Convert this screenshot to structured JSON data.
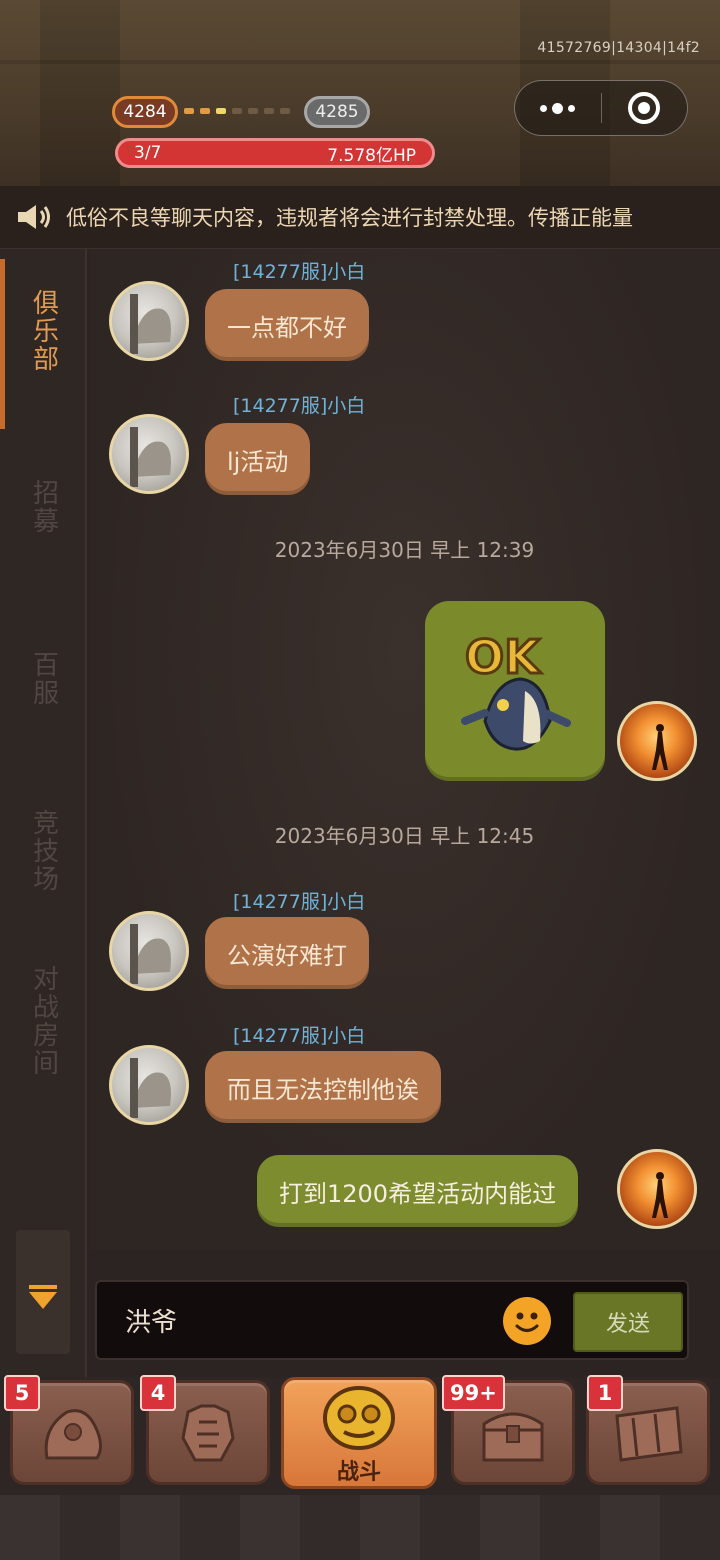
{
  "header": {
    "id_text": "41572769|14304|14f2",
    "level_current": "4284",
    "level_next": "4285",
    "wave": "3/7",
    "boss_hp": "7.578亿HP"
  },
  "notice": {
    "text": "低俗不良等聊天内容，违规者将会进行封禁处理。传播正能量"
  },
  "sidebar": {
    "tabs": [
      {
        "label": "俱乐部",
        "active": true
      },
      {
        "label": "招募",
        "active": false
      },
      {
        "label": "百服",
        "active": false
      },
      {
        "label": "竞技场",
        "active": false
      },
      {
        "label": "对战房间",
        "active": false
      }
    ]
  },
  "chat": {
    "messages": [
      {
        "sender": "[14277服]小白",
        "text": "一点都不好",
        "side": "left"
      },
      {
        "sender": "[14277服]小白",
        "text": "lj活动",
        "side": "left"
      },
      {
        "timestamp": "2023年6月30日  早上  12:39"
      },
      {
        "sticker_text": "OK",
        "side": "right"
      },
      {
        "timestamp": "2023年6月30日  早上  12:45"
      },
      {
        "sender": "[14277服]小白",
        "text": "公演好难打",
        "side": "left"
      },
      {
        "sender": "[14277服]小白",
        "text": "而且无法控制他诶",
        "side": "left"
      },
      {
        "text": "打到1200希望活动内能过",
        "side": "right"
      }
    ]
  },
  "input": {
    "value": "洪爷",
    "send_label": "发送"
  },
  "bottom_nav": {
    "items": [
      {
        "icon": "hero-icon",
        "badge": "5"
      },
      {
        "icon": "armor-icon",
        "badge": "4"
      },
      {
        "icon": "battle-icon",
        "label": "战斗",
        "active": true
      },
      {
        "icon": "chest-icon",
        "badge": "99+"
      },
      {
        "icon": "map-icon",
        "badge": "1"
      }
    ]
  },
  "colors": {
    "accent": "#e19a50",
    "left_bubble": "#b07248",
    "right_bubble": "#7d8c2e",
    "hp_bar": "#d33434",
    "badge": "#d8323a"
  }
}
